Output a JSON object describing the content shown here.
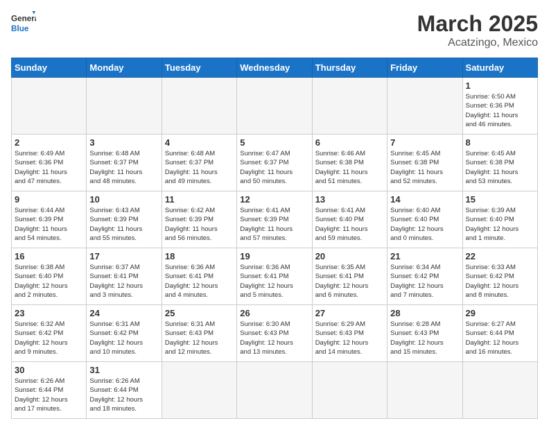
{
  "header": {
    "logo_general": "General",
    "logo_blue": "Blue",
    "title": "March 2025",
    "subtitle": "Acatzingo, Mexico"
  },
  "days_of_week": [
    "Sunday",
    "Monday",
    "Tuesday",
    "Wednesday",
    "Thursday",
    "Friday",
    "Saturday"
  ],
  "weeks": [
    [
      {
        "day": "",
        "info": ""
      },
      {
        "day": "",
        "info": ""
      },
      {
        "day": "",
        "info": ""
      },
      {
        "day": "",
        "info": ""
      },
      {
        "day": "",
        "info": ""
      },
      {
        "day": "",
        "info": ""
      },
      {
        "day": "1",
        "info": "Sunrise: 6:50 AM\nSunset: 6:36 PM\nDaylight: 11 hours\nand 46 minutes."
      }
    ],
    [
      {
        "day": "2",
        "info": "Sunrise: 6:49 AM\nSunset: 6:36 PM\nDaylight: 11 hours\nand 47 minutes."
      },
      {
        "day": "3",
        "info": "Sunrise: 6:48 AM\nSunset: 6:37 PM\nDaylight: 11 hours\nand 48 minutes."
      },
      {
        "day": "4",
        "info": "Sunrise: 6:48 AM\nSunset: 6:37 PM\nDaylight: 11 hours\nand 49 minutes."
      },
      {
        "day": "5",
        "info": "Sunrise: 6:47 AM\nSunset: 6:37 PM\nDaylight: 11 hours\nand 50 minutes."
      },
      {
        "day": "6",
        "info": "Sunrise: 6:46 AM\nSunset: 6:38 PM\nDaylight: 11 hours\nand 51 minutes."
      },
      {
        "day": "7",
        "info": "Sunrise: 6:45 AM\nSunset: 6:38 PM\nDaylight: 11 hours\nand 52 minutes."
      },
      {
        "day": "8",
        "info": "Sunrise: 6:45 AM\nSunset: 6:38 PM\nDaylight: 11 hours\nand 53 minutes."
      }
    ],
    [
      {
        "day": "9",
        "info": "Sunrise: 6:44 AM\nSunset: 6:39 PM\nDaylight: 11 hours\nand 54 minutes."
      },
      {
        "day": "10",
        "info": "Sunrise: 6:43 AM\nSunset: 6:39 PM\nDaylight: 11 hours\nand 55 minutes."
      },
      {
        "day": "11",
        "info": "Sunrise: 6:42 AM\nSunset: 6:39 PM\nDaylight: 11 hours\nand 56 minutes."
      },
      {
        "day": "12",
        "info": "Sunrise: 6:41 AM\nSunset: 6:39 PM\nDaylight: 11 hours\nand 57 minutes."
      },
      {
        "day": "13",
        "info": "Sunrise: 6:41 AM\nSunset: 6:40 PM\nDaylight: 11 hours\nand 59 minutes."
      },
      {
        "day": "14",
        "info": "Sunrise: 6:40 AM\nSunset: 6:40 PM\nDaylight: 12 hours\nand 0 minutes."
      },
      {
        "day": "15",
        "info": "Sunrise: 6:39 AM\nSunset: 6:40 PM\nDaylight: 12 hours\nand 1 minute."
      }
    ],
    [
      {
        "day": "16",
        "info": "Sunrise: 6:38 AM\nSunset: 6:40 PM\nDaylight: 12 hours\nand 2 minutes."
      },
      {
        "day": "17",
        "info": "Sunrise: 6:37 AM\nSunset: 6:41 PM\nDaylight: 12 hours\nand 3 minutes."
      },
      {
        "day": "18",
        "info": "Sunrise: 6:36 AM\nSunset: 6:41 PM\nDaylight: 12 hours\nand 4 minutes."
      },
      {
        "day": "19",
        "info": "Sunrise: 6:36 AM\nSunset: 6:41 PM\nDaylight: 12 hours\nand 5 minutes."
      },
      {
        "day": "20",
        "info": "Sunrise: 6:35 AM\nSunset: 6:41 PM\nDaylight: 12 hours\nand 6 minutes."
      },
      {
        "day": "21",
        "info": "Sunrise: 6:34 AM\nSunset: 6:42 PM\nDaylight: 12 hours\nand 7 minutes."
      },
      {
        "day": "22",
        "info": "Sunrise: 6:33 AM\nSunset: 6:42 PM\nDaylight: 12 hours\nand 8 minutes."
      }
    ],
    [
      {
        "day": "23",
        "info": "Sunrise: 6:32 AM\nSunset: 6:42 PM\nDaylight: 12 hours\nand 9 minutes."
      },
      {
        "day": "24",
        "info": "Sunrise: 6:31 AM\nSunset: 6:42 PM\nDaylight: 12 hours\nand 10 minutes."
      },
      {
        "day": "25",
        "info": "Sunrise: 6:31 AM\nSunset: 6:43 PM\nDaylight: 12 hours\nand 12 minutes."
      },
      {
        "day": "26",
        "info": "Sunrise: 6:30 AM\nSunset: 6:43 PM\nDaylight: 12 hours\nand 13 minutes."
      },
      {
        "day": "27",
        "info": "Sunrise: 6:29 AM\nSunset: 6:43 PM\nDaylight: 12 hours\nand 14 minutes."
      },
      {
        "day": "28",
        "info": "Sunrise: 6:28 AM\nSunset: 6:43 PM\nDaylight: 12 hours\nand 15 minutes."
      },
      {
        "day": "29",
        "info": "Sunrise: 6:27 AM\nSunset: 6:44 PM\nDaylight: 12 hours\nand 16 minutes."
      }
    ],
    [
      {
        "day": "30",
        "info": "Sunrise: 6:26 AM\nSunset: 6:44 PM\nDaylight: 12 hours\nand 17 minutes."
      },
      {
        "day": "31",
        "info": "Sunrise: 6:26 AM\nSunset: 6:44 PM\nDaylight: 12 hours\nand 18 minutes."
      },
      {
        "day": "",
        "info": ""
      },
      {
        "day": "",
        "info": ""
      },
      {
        "day": "",
        "info": ""
      },
      {
        "day": "",
        "info": ""
      },
      {
        "day": "",
        "info": ""
      }
    ]
  ]
}
